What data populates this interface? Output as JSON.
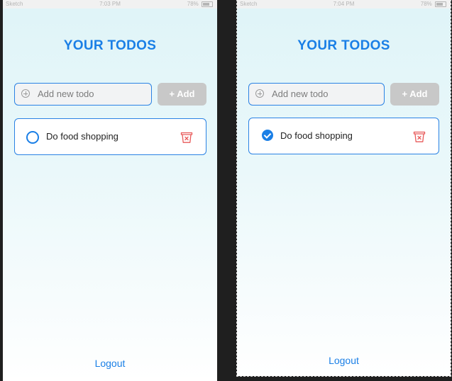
{
  "screens": {
    "left": {
      "status": {
        "carrier": "Sketch",
        "time": "7:03 PM",
        "battery": "78%"
      },
      "title": "YOUR TODOS",
      "input_placeholder": "Add new todo",
      "add_label": "+ Add",
      "todo": {
        "text": "Do food shopping",
        "completed": false
      },
      "logout_label": "Logout"
    },
    "right": {
      "status": {
        "carrier": "Sketch",
        "time": "7:04 PM",
        "battery": "78%"
      },
      "title": "YOUR TODOS",
      "input_placeholder": "Add new todo",
      "add_label": "+ Add",
      "todo": {
        "text": "Do food shopping",
        "completed": true
      },
      "logout_label": "Logout"
    }
  },
  "icons": {
    "add": "plus-circle-icon",
    "check_empty": "circle-outline-icon",
    "check_done": "check-circle-icon",
    "delete": "trash-icon"
  },
  "colors": {
    "accent": "#1a7fe6",
    "delete": "#e85a5a",
    "button_disabled": "#c8c8c8"
  }
}
